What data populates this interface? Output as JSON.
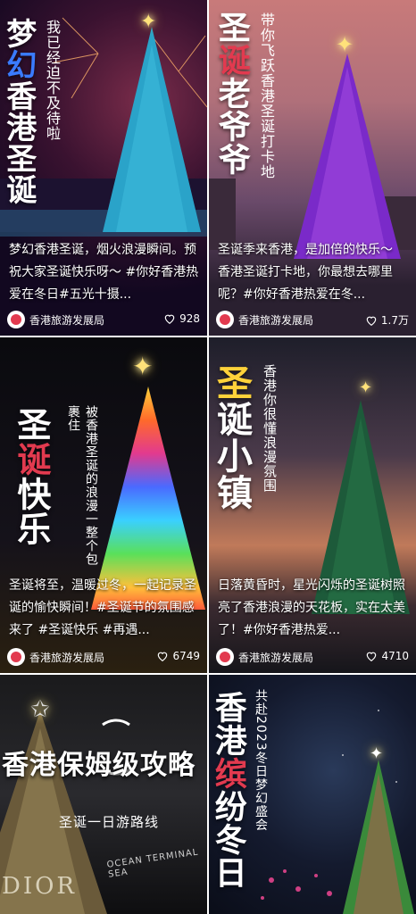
{
  "cards": [
    {
      "title_chars": [
        "梦",
        "幻",
        "香",
        "港",
        "圣",
        "诞"
      ],
      "subtitle": "我已经迫不及待啦",
      "caption": "梦幻香港圣诞，烟火浪漫瞬间。预祝大家圣诞快乐呀～ #你好香港热爱在冬日#五光十摄...",
      "author": "香港旅游发展局",
      "likes": "928"
    },
    {
      "title_chars": [
        "圣",
        "诞",
        "老",
        "爷",
        "爷"
      ],
      "subtitle": "带你飞跃香港圣诞打卡地",
      "caption": "圣诞季来香港，是加倍的快乐～ 香港圣诞打卡地，你最想去哪里呢？#你好香港热爱在冬...",
      "author": "香港旅游发展局",
      "likes": "1.7万"
    },
    {
      "title_chars": [
        "圣",
        "诞",
        "快",
        "乐"
      ],
      "subtitle": "被香港圣诞的浪漫一整个包裹住",
      "caption": "圣诞将至，温暖过冬，一起记录圣诞的愉快瞬间！#圣诞节的氛围感来了 #圣诞快乐 #再遇...",
      "author": "香港旅游发展局",
      "likes": "6749"
    },
    {
      "title_chars": [
        "圣",
        "诞",
        "小",
        "镇"
      ],
      "subtitle": "香港你很懂浪漫氛围",
      "caption": "日落黄昏时，星光闪烁的圣诞树照亮了香港浪漫的天花板，实在太美了！#你好香港热爱...",
      "author": "香港旅游发展局",
      "likes": "4710"
    },
    {
      "title": "香港保姆级攻略",
      "subtitle": "圣诞一日游路线",
      "store_sign": "DIOR",
      "store_sign2": "OCEAN TERMINAL SEA"
    },
    {
      "title_chars": [
        "香",
        "港",
        "缤",
        "纷",
        "冬",
        "日"
      ],
      "subtitle": "共赴2023冬日梦幻盛会"
    }
  ],
  "colors": {
    "accent_red": "#e23a4f",
    "accent_yellow": "#ffd23a",
    "accent_blue": "#3a7bff"
  }
}
